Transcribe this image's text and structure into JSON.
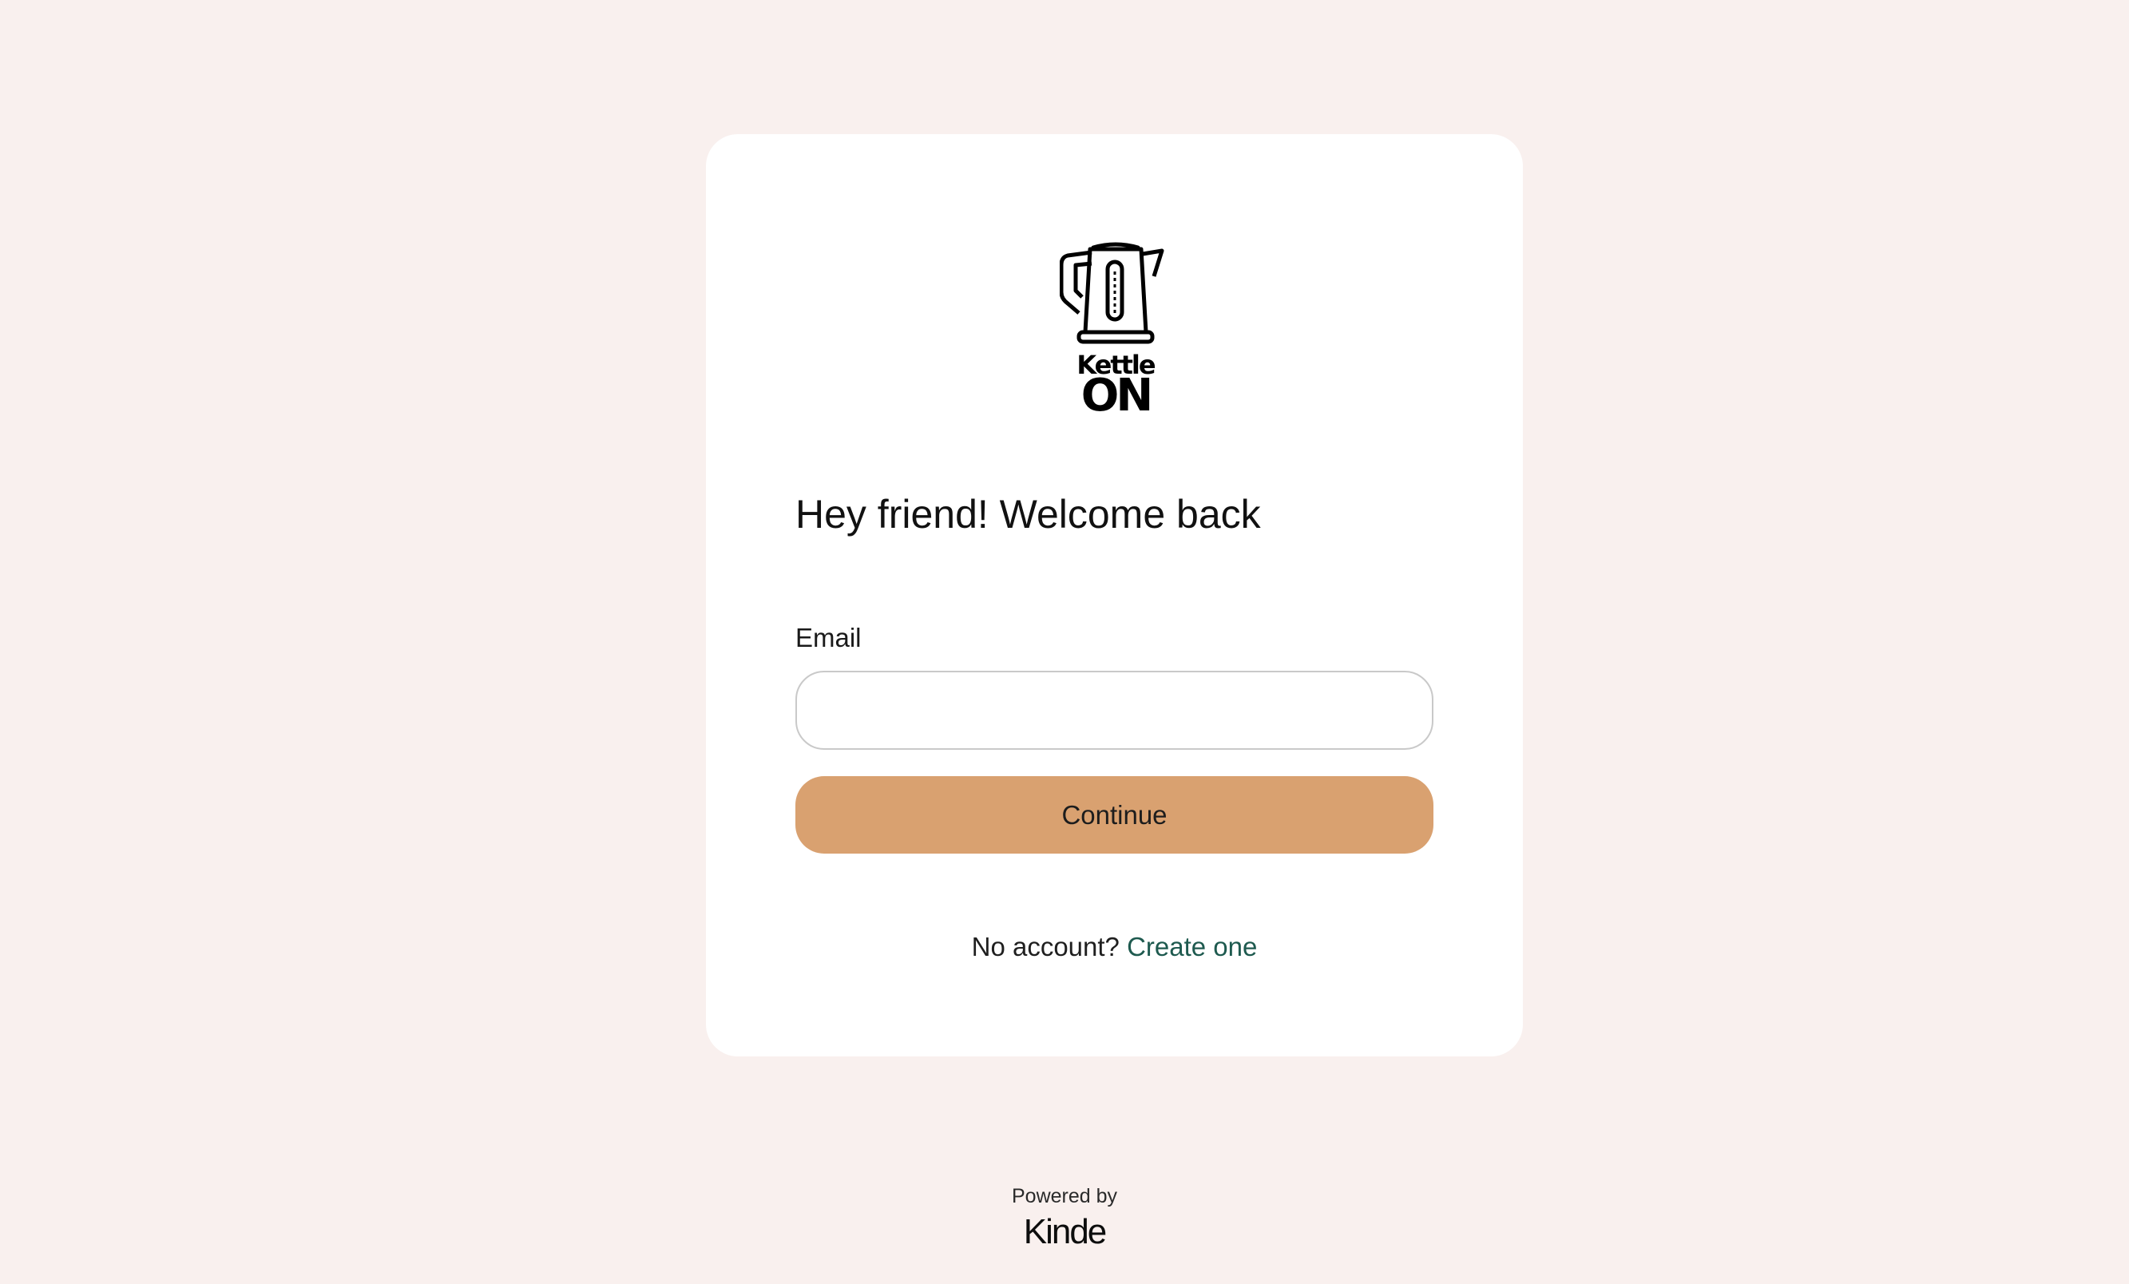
{
  "brand": {
    "logo_word_top": "Kettle",
    "logo_word_bottom": "ON",
    "logo_icon": "kettle-icon"
  },
  "login": {
    "heading": "Hey friend! Welcome back",
    "email_label": "Email",
    "email_value": "",
    "email_placeholder": "",
    "continue_label": "Continue",
    "no_account_text": "No account?",
    "create_link_label": "Create one"
  },
  "footer": {
    "powered_by": "Powered by",
    "provider": "Kinde"
  },
  "colors": {
    "background": "#f9f0ee",
    "card": "#ffffff",
    "button": "#d9a170",
    "link": "#1e5a4f"
  }
}
